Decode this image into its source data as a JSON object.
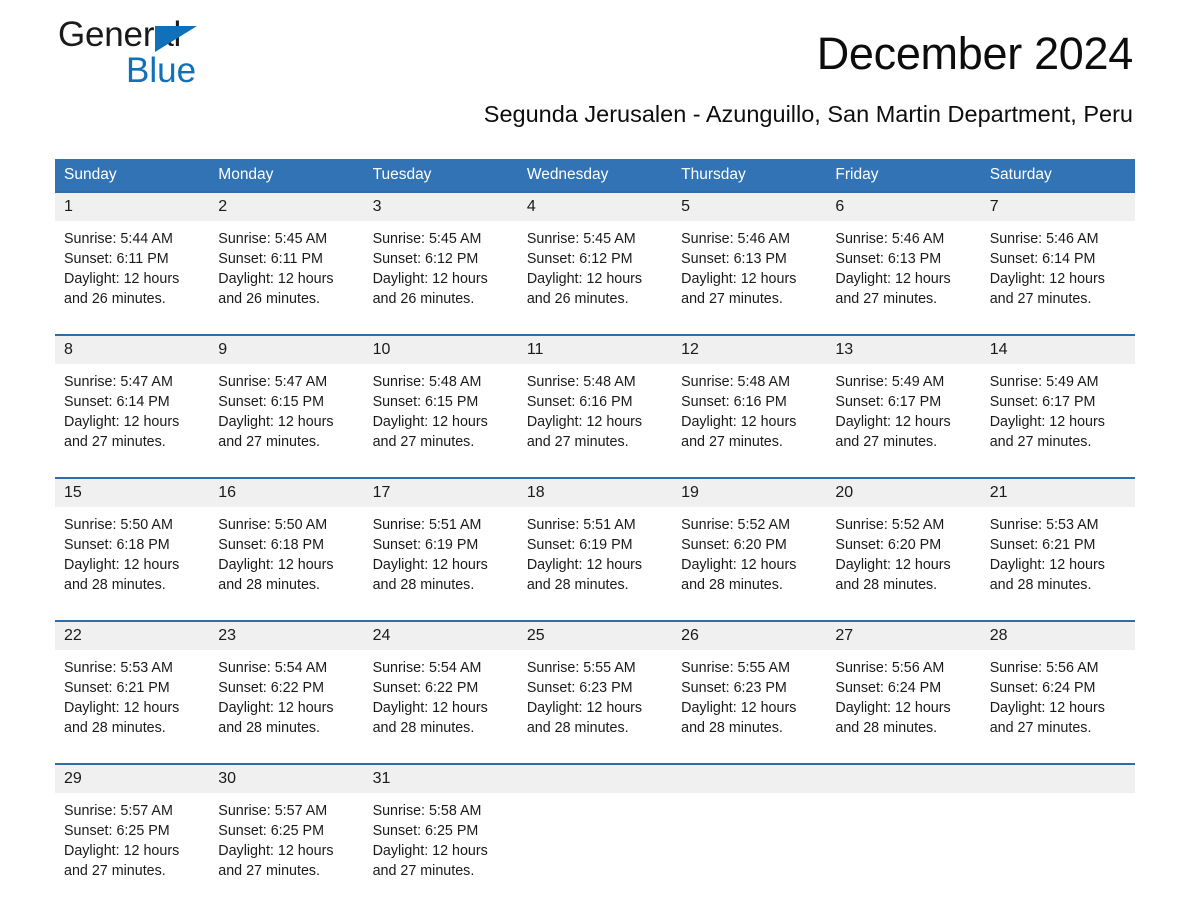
{
  "brand": {
    "name_part1": "General",
    "name_part2": "Blue",
    "triangle_color": "#1070ba",
    "accent_color": "#1070ba"
  },
  "header": {
    "title": "December 2024",
    "subtitle": "Segunda Jerusalen - Azunguillo, San Martin Department, Peru"
  },
  "theme": {
    "header_bg": "#3173b4",
    "week_rule": "#2e6da8",
    "daynum_bg": "#f0f0f0",
    "text": "#1a1a1a"
  },
  "calendar": {
    "weekdays": [
      "Sunday",
      "Monday",
      "Tuesday",
      "Wednesday",
      "Thursday",
      "Friday",
      "Saturday"
    ],
    "weeks": [
      {
        "daynums": [
          "1",
          "2",
          "3",
          "4",
          "5",
          "6",
          "7"
        ],
        "cells": [
          {
            "line1": "Sunrise: 5:44 AM",
            "line2": "Sunset: 6:11 PM",
            "line3": "Daylight: 12 hours",
            "line4": "and 26 minutes."
          },
          {
            "line1": "Sunrise: 5:45 AM",
            "line2": "Sunset: 6:11 PM",
            "line3": "Daylight: 12 hours",
            "line4": "and 26 minutes."
          },
          {
            "line1": "Sunrise: 5:45 AM",
            "line2": "Sunset: 6:12 PM",
            "line3": "Daylight: 12 hours",
            "line4": "and 26 minutes."
          },
          {
            "line1": "Sunrise: 5:45 AM",
            "line2": "Sunset: 6:12 PM",
            "line3": "Daylight: 12 hours",
            "line4": "and 26 minutes."
          },
          {
            "line1": "Sunrise: 5:46 AM",
            "line2": "Sunset: 6:13 PM",
            "line3": "Daylight: 12 hours",
            "line4": "and 27 minutes."
          },
          {
            "line1": "Sunrise: 5:46 AM",
            "line2": "Sunset: 6:13 PM",
            "line3": "Daylight: 12 hours",
            "line4": "and 27 minutes."
          },
          {
            "line1": "Sunrise: 5:46 AM",
            "line2": "Sunset: 6:14 PM",
            "line3": "Daylight: 12 hours",
            "line4": "and 27 minutes."
          }
        ]
      },
      {
        "daynums": [
          "8",
          "9",
          "10",
          "11",
          "12",
          "13",
          "14"
        ],
        "cells": [
          {
            "line1": "Sunrise: 5:47 AM",
            "line2": "Sunset: 6:14 PM",
            "line3": "Daylight: 12 hours",
            "line4": "and 27 minutes."
          },
          {
            "line1": "Sunrise: 5:47 AM",
            "line2": "Sunset: 6:15 PM",
            "line3": "Daylight: 12 hours",
            "line4": "and 27 minutes."
          },
          {
            "line1": "Sunrise: 5:48 AM",
            "line2": "Sunset: 6:15 PM",
            "line3": "Daylight: 12 hours",
            "line4": "and 27 minutes."
          },
          {
            "line1": "Sunrise: 5:48 AM",
            "line2": "Sunset: 6:16 PM",
            "line3": "Daylight: 12 hours",
            "line4": "and 27 minutes."
          },
          {
            "line1": "Sunrise: 5:48 AM",
            "line2": "Sunset: 6:16 PM",
            "line3": "Daylight: 12 hours",
            "line4": "and 27 minutes."
          },
          {
            "line1": "Sunrise: 5:49 AM",
            "line2": "Sunset: 6:17 PM",
            "line3": "Daylight: 12 hours",
            "line4": "and 27 minutes."
          },
          {
            "line1": "Sunrise: 5:49 AM",
            "line2": "Sunset: 6:17 PM",
            "line3": "Daylight: 12 hours",
            "line4": "and 27 minutes."
          }
        ]
      },
      {
        "daynums": [
          "15",
          "16",
          "17",
          "18",
          "19",
          "20",
          "21"
        ],
        "cells": [
          {
            "line1": "Sunrise: 5:50 AM",
            "line2": "Sunset: 6:18 PM",
            "line3": "Daylight: 12 hours",
            "line4": "and 28 minutes."
          },
          {
            "line1": "Sunrise: 5:50 AM",
            "line2": "Sunset: 6:18 PM",
            "line3": "Daylight: 12 hours",
            "line4": "and 28 minutes."
          },
          {
            "line1": "Sunrise: 5:51 AM",
            "line2": "Sunset: 6:19 PM",
            "line3": "Daylight: 12 hours",
            "line4": "and 28 minutes."
          },
          {
            "line1": "Sunrise: 5:51 AM",
            "line2": "Sunset: 6:19 PM",
            "line3": "Daylight: 12 hours",
            "line4": "and 28 minutes."
          },
          {
            "line1": "Sunrise: 5:52 AM",
            "line2": "Sunset: 6:20 PM",
            "line3": "Daylight: 12 hours",
            "line4": "and 28 minutes."
          },
          {
            "line1": "Sunrise: 5:52 AM",
            "line2": "Sunset: 6:20 PM",
            "line3": "Daylight: 12 hours",
            "line4": "and 28 minutes."
          },
          {
            "line1": "Sunrise: 5:53 AM",
            "line2": "Sunset: 6:21 PM",
            "line3": "Daylight: 12 hours",
            "line4": "and 28 minutes."
          }
        ]
      },
      {
        "daynums": [
          "22",
          "23",
          "24",
          "25",
          "26",
          "27",
          "28"
        ],
        "cells": [
          {
            "line1": "Sunrise: 5:53 AM",
            "line2": "Sunset: 6:21 PM",
            "line3": "Daylight: 12 hours",
            "line4": "and 28 minutes."
          },
          {
            "line1": "Sunrise: 5:54 AM",
            "line2": "Sunset: 6:22 PM",
            "line3": "Daylight: 12 hours",
            "line4": "and 28 minutes."
          },
          {
            "line1": "Sunrise: 5:54 AM",
            "line2": "Sunset: 6:22 PM",
            "line3": "Daylight: 12 hours",
            "line4": "and 28 minutes."
          },
          {
            "line1": "Sunrise: 5:55 AM",
            "line2": "Sunset: 6:23 PM",
            "line3": "Daylight: 12 hours",
            "line4": "and 28 minutes."
          },
          {
            "line1": "Sunrise: 5:55 AM",
            "line2": "Sunset: 6:23 PM",
            "line3": "Daylight: 12 hours",
            "line4": "and 28 minutes."
          },
          {
            "line1": "Sunrise: 5:56 AM",
            "line2": "Sunset: 6:24 PM",
            "line3": "Daylight: 12 hours",
            "line4": "and 28 minutes."
          },
          {
            "line1": "Sunrise: 5:56 AM",
            "line2": "Sunset: 6:24 PM",
            "line3": "Daylight: 12 hours",
            "line4": "and 27 minutes."
          }
        ]
      },
      {
        "daynums": [
          "29",
          "30",
          "31",
          "",
          "",
          "",
          ""
        ],
        "cells": [
          {
            "line1": "Sunrise: 5:57 AM",
            "line2": "Sunset: 6:25 PM",
            "line3": "Daylight: 12 hours",
            "line4": "and 27 minutes."
          },
          {
            "line1": "Sunrise: 5:57 AM",
            "line2": "Sunset: 6:25 PM",
            "line3": "Daylight: 12 hours",
            "line4": "and 27 minutes."
          },
          {
            "line1": "Sunrise: 5:58 AM",
            "line2": "Sunset: 6:25 PM",
            "line3": "Daylight: 12 hours",
            "line4": "and 27 minutes."
          },
          {
            "line1": "",
            "line2": "",
            "line3": "",
            "line4": ""
          },
          {
            "line1": "",
            "line2": "",
            "line3": "",
            "line4": ""
          },
          {
            "line1": "",
            "line2": "",
            "line3": "",
            "line4": ""
          },
          {
            "line1": "",
            "line2": "",
            "line3": "",
            "line4": ""
          }
        ]
      }
    ]
  }
}
